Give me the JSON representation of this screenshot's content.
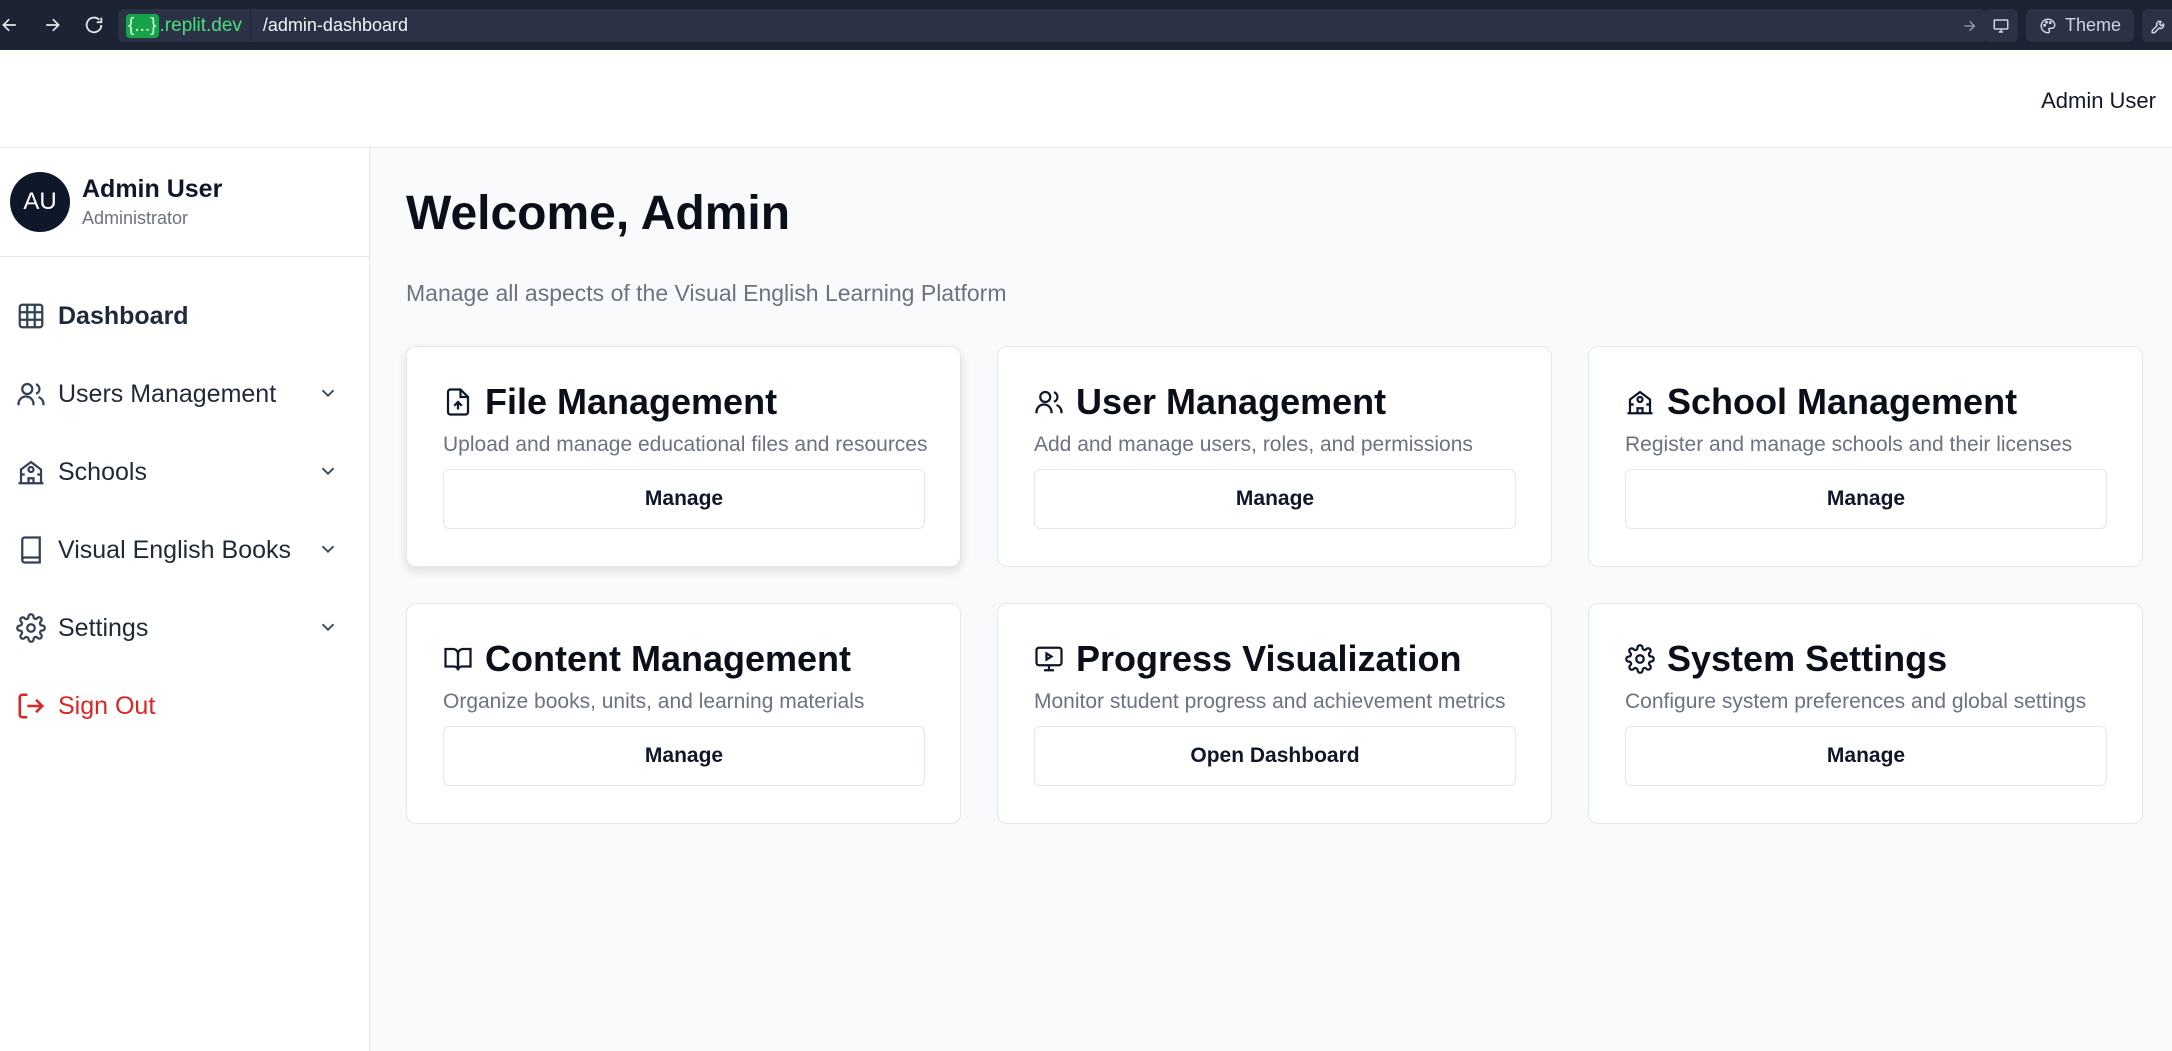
{
  "browser": {
    "url_domain_prefix": "{...}",
    "url_domain_suffix": ".replit.dev",
    "url_path": "/admin-dashboard",
    "theme_label": "Theme"
  },
  "header": {
    "user_label": "Admin User"
  },
  "sidebar": {
    "profile": {
      "initials": "AU",
      "name": "Admin User",
      "role": "Administrator"
    },
    "items": [
      {
        "label": "Dashboard",
        "icon": "grid-icon",
        "active": true
      },
      {
        "label": "Users Management",
        "icon": "users-icon",
        "expandable": true
      },
      {
        "label": "Schools",
        "icon": "school-icon",
        "expandable": true
      },
      {
        "label": "Visual English Books",
        "icon": "book-icon",
        "expandable": true
      },
      {
        "label": "Settings",
        "icon": "gear-icon",
        "expandable": true
      }
    ],
    "sign_out": "Sign Out"
  },
  "main": {
    "title": "Welcome, Admin",
    "subtitle": "Manage all aspects of the Visual English Learning Platform",
    "cards": [
      {
        "title": "File Management",
        "description": "Upload and manage educational files and resources",
        "button": "Manage",
        "icon": "file-upload-icon"
      },
      {
        "title": "User Management",
        "description": "Add and manage users, roles, and permissions",
        "button": "Manage",
        "icon": "users-icon"
      },
      {
        "title": "School Management",
        "description": "Register and manage schools and their licenses",
        "button": "Manage",
        "icon": "school-icon"
      },
      {
        "title": "Content Management",
        "description": "Organize books, units, and learning materials",
        "button": "Manage",
        "icon": "open-book-icon"
      },
      {
        "title": "Progress Visualization",
        "description": "Monitor student progress and achievement metrics",
        "button": "Open Dashboard",
        "icon": "presentation-icon"
      },
      {
        "title": "System Settings",
        "description": "Configure system preferences and global settings",
        "button": "Manage",
        "icon": "gear-icon"
      }
    ]
  },
  "colors": {
    "accent_dark": "#0f172a",
    "danger": "#dc2626",
    "muted_text": "#6b7280",
    "browser_bar": "#1c2333",
    "domain_green": "#4ade80"
  }
}
